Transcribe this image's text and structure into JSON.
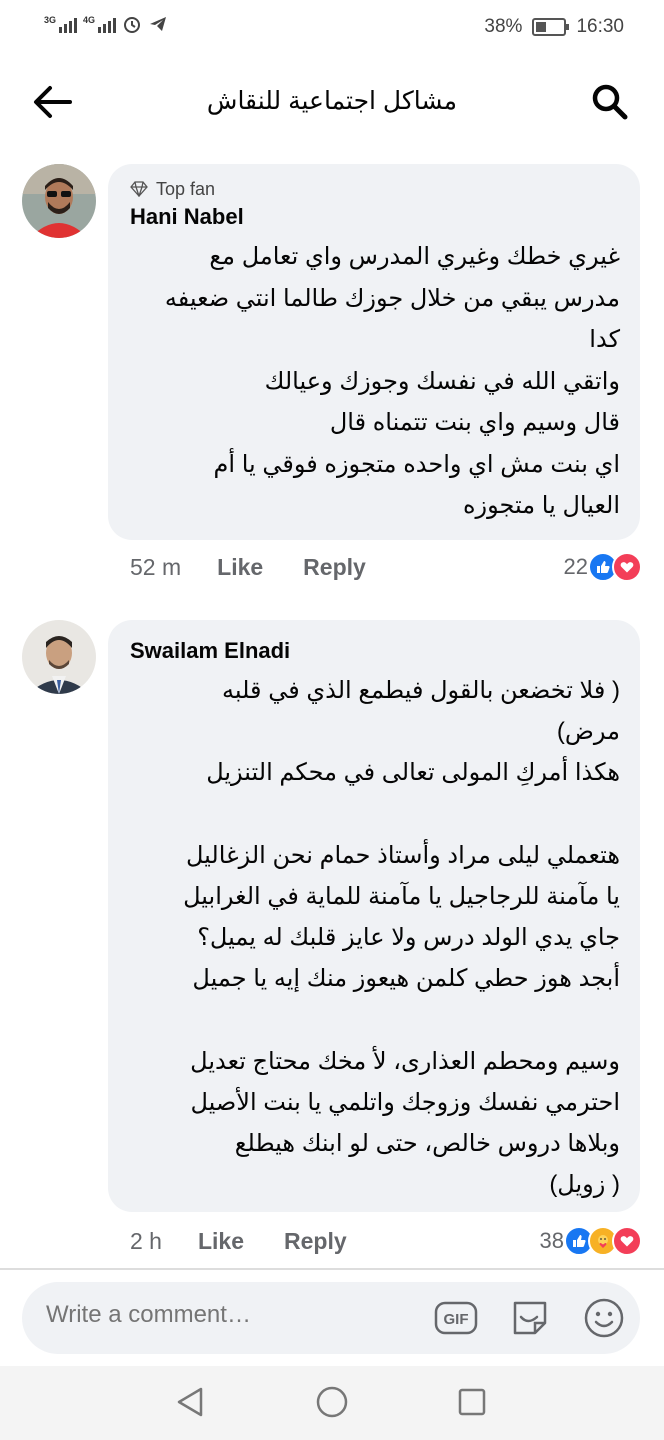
{
  "status_bar": {
    "network_1": "3G",
    "network_2": "4G",
    "battery": "38%",
    "battery_level": 0.38,
    "time": "16:30"
  },
  "header": {
    "title": "مشاكل اجتماعية للنقاش",
    "back_icon": "arrow-left-icon",
    "search_icon": "search-icon"
  },
  "comments": [
    {
      "badge": "Top fan",
      "author": "Hani Nabel",
      "text": "غيري خطك وغيري المدرس واي تعامل مع\nمدرس يبقي من خلال جوزك طالما انتي ضعيفه\nكدا\nواتقي الله في نفسك وجوزك وعيالك\nقال وسيم واي بنت تتمناه قال\nاي بنت مش اي واحده متجوزه فوقي يا أم\nالعيال يا متجوزه",
      "time": "52 m",
      "like_label": "Like",
      "reply_label": "Reply",
      "reaction_count": "22",
      "reactions": [
        "like",
        "love"
      ]
    },
    {
      "badge": "",
      "author": "Swailam Elnadi",
      "text": "( فلا تخضعن بالقول فيطمع الذي في قلبه\nمرض)\nهكذا أمركِ المولى تعالى في محكم التنزيل\n\nهتعملي ليلى مراد وأستاذ حمام نحن الزغاليل\nيا مآمنة للرجاجيل يا مآمنة للماية في الغرابيل\nجاي يدي الولد درس ولا عايز قلبك له يميل؟\nأبجد هوز حطي كلمن هيعوز منك إيه يا جميل\n\nوسيم ومحطم العذارى، لأ مخك محتاج تعديل\nاحترمي نفسك وزوجك واتلمي يا بنت الأصيل\nوبلاها دروس خالص، حتى لو ابنك هيطلع\n( زويل)",
      "time": "2 h",
      "like_label": "Like",
      "reply_label": "Reply",
      "reaction_count": "38",
      "reactions": [
        "like",
        "care",
        "love"
      ]
    }
  ],
  "composer": {
    "placeholder": "Write a comment…",
    "gif_label": "GIF"
  },
  "colors": {
    "like_blue": "#1877f2",
    "love_red": "#f33e58",
    "care_yellow": "#f7b125",
    "bubble_bg": "#f0f2f5",
    "muted_text": "#65676b"
  }
}
